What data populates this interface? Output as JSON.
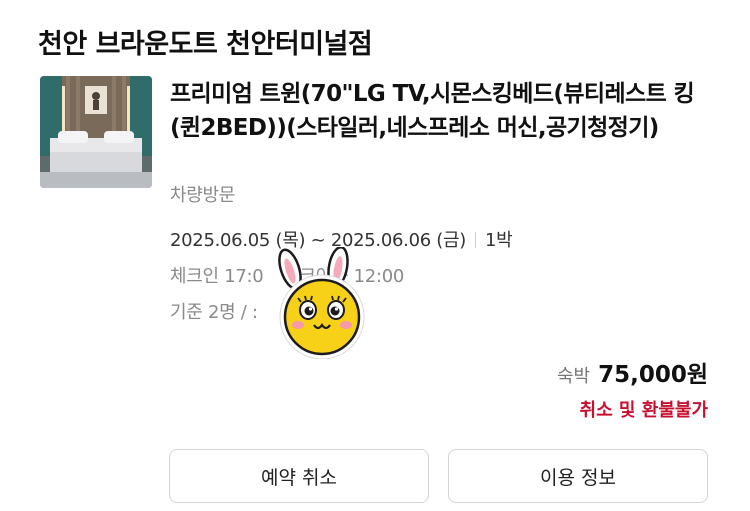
{
  "hotel": {
    "name": "천안 브라운도트 천안터미널점"
  },
  "room": {
    "title": "프리미엄 트윈(70\"LG TV,시몬스킹베드(뷰티레스트 킹(퀸2BED))(스타일러,네스프레소 머신,공기청정기)",
    "visit_type": "차량방문",
    "thumbnail_icon": "hotel-room-photo"
  },
  "stay": {
    "checkin_date": "2025.06.05 (목)",
    "date_separator": "~",
    "checkout_date": "2025.06.06 (금)",
    "nights": "1박",
    "checkin_visible": "체크인 17:0",
    "checkout_visible": "크아웃 12:00",
    "guests_visible": "기준 2명 / :"
  },
  "price": {
    "label": "숙박",
    "amount": "75,000원"
  },
  "refund_note": "취소 및 환불불가",
  "buttons": {
    "cancel": "예약 취소",
    "info": "이용 정보"
  },
  "colors": {
    "accent_red": "#c8102e",
    "text_gray": "#8a8a8a",
    "sticker_yellow": "#f7d117"
  },
  "sticker": {
    "icon": "bunny-character-sticker"
  }
}
